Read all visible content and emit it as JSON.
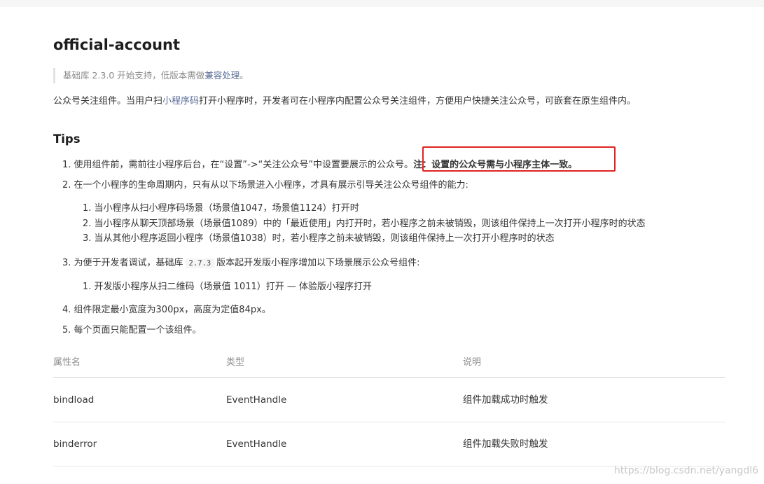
{
  "title": "official-account",
  "note": {
    "prefix": "基础库 2.3.0 开始支持，低版本需做",
    "link": "兼容处理",
    "suffix": "。"
  },
  "description": {
    "prefix": "公众号关注组件。当用户扫",
    "link": "小程序码",
    "suffix": "打开小程序时，开发者可在小程序内配置公众号关注组件，方便用户快捷关注公众号，可嵌套在原生组件内。"
  },
  "tips_heading": "Tips",
  "tips": {
    "t1": {
      "text": "1. 使用组件前，需前往小程序后台，在“设置”->“关注公众号”中设置要展示的公众号。",
      "strong": "注：设置的公众号需与小程序主体一致。"
    },
    "t2": "2. 在一个小程序的生命周期内，只有从以下场景进入小程序，才具有展示引导关注公众号组件的能力:",
    "t2_sub": [
      "1. 当小程序从扫小程序码场景（场景值1047，场景值1124）打开时",
      "2. 当小程序从聊天顶部场景（场景值1089）中的「最近使用」内打开时，若小程序之前未被销毁，则该组件保持上一次打开小程序时的状态",
      "3. 当从其他小程序返回小程序（场景值1038）时，若小程序之前未被销毁，则该组件保持上一次打开小程序时的状态"
    ],
    "t3": {
      "prefix": "3. 为便于开发者调试，基础库",
      "code": "2.7.3",
      "suffix": "版本起开发版小程序增加以下场景展示公众号组件:"
    },
    "t3_sub": [
      "1. 开发版小程序从扫二维码（场景值 1011）打开 — 体验版小程序打开"
    ],
    "t4": "4. 组件限定最小宽度为300px，高度为定值84px。",
    "t5": "5. 每个页面只能配置一个该组件。"
  },
  "table": {
    "headers": [
      "属性名",
      "类型",
      "说明"
    ],
    "rows": [
      [
        "bindload",
        "EventHandle",
        "组件加载成功时触发"
      ],
      [
        "binderror",
        "EventHandle",
        "组件加载失败时触发"
      ]
    ]
  },
  "watermark": "https://blog.csdn.net/yangdl6",
  "colors": {
    "link": "#576b95",
    "highlight_box": "#e0231f"
  }
}
